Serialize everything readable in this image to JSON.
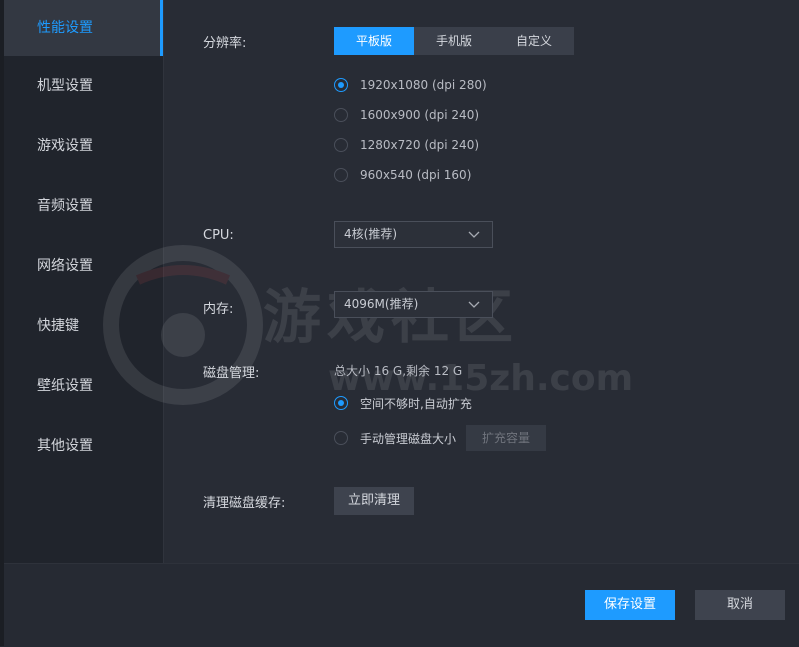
{
  "sidebar": {
    "items": [
      {
        "label": "性能设置",
        "active": true
      },
      {
        "label": "机型设置",
        "active": false
      },
      {
        "label": "游戏设置",
        "active": false
      },
      {
        "label": "音频设置",
        "active": false
      },
      {
        "label": "网络设置",
        "active": false
      },
      {
        "label": "快捷键",
        "active": false
      },
      {
        "label": "壁纸设置",
        "active": false
      },
      {
        "label": "其他设置",
        "active": false
      }
    ]
  },
  "performance": {
    "resolution_label": "分辨率:",
    "resolution_tabs": [
      "平板版",
      "手机版",
      "自定义"
    ],
    "selected_tab": "平板版",
    "resolution_options": [
      "1920x1080 (dpi 280)",
      "1600x900  (dpi 240)",
      "1280x720  (dpi 240)",
      "960x540  (dpi 160)"
    ],
    "selected_resolution": "1920x1080 (dpi 280)",
    "cpu_label": "CPU:",
    "cpu_value": "4核(推荐)",
    "memory_label": "内存:",
    "memory_value": "4096M(推荐)",
    "disk_label": "磁盘管理:",
    "disk_info": "总大小 16 G,剩余 12 G",
    "disk_auto_option": "空间不够时,自动扩充",
    "disk_manual_option": "手动管理磁盘大小",
    "disk_selected": "auto",
    "expand_button": "扩充容量",
    "cache_label": "清理磁盘缓存:",
    "clear_button": "立即清理"
  },
  "watermark": {
    "text": "游戏社区",
    "url": "www.15zh.com"
  },
  "footer": {
    "save_button": "保存设置",
    "cancel_button": "取消"
  },
  "colors": {
    "accent": "#1e9bff",
    "sidebar_bg": "#20242c",
    "main_bg": "#282c35"
  }
}
